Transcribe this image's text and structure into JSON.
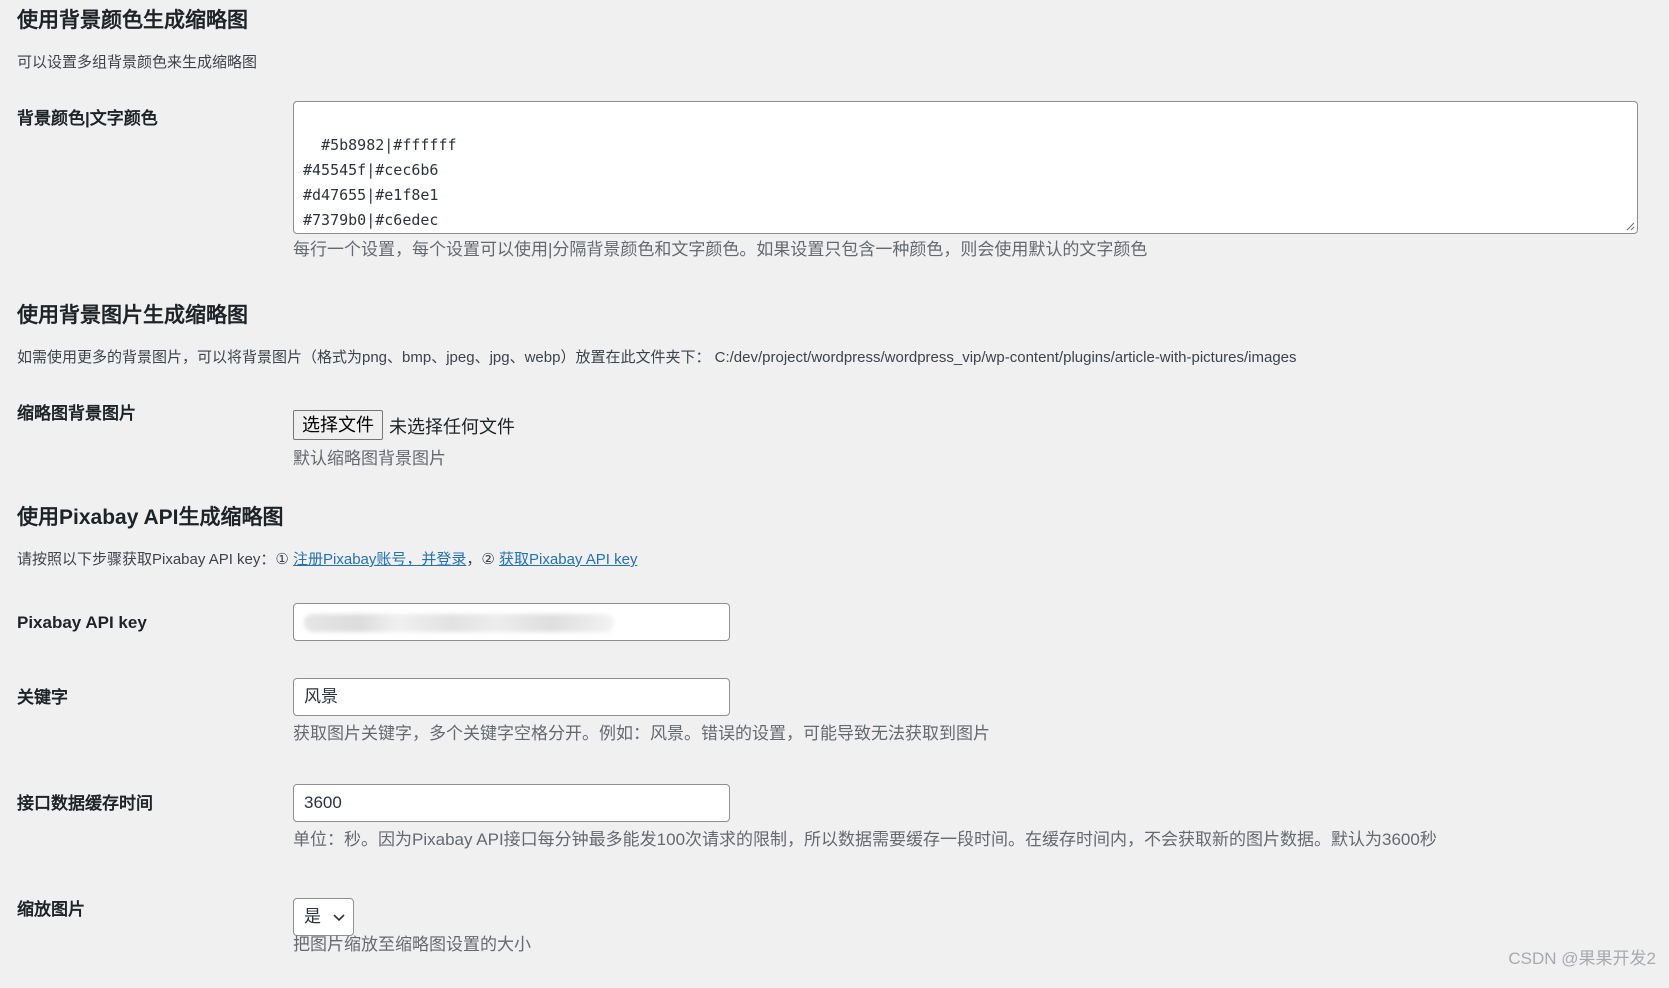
{
  "sections": {
    "background_color": {
      "title": "使用背景颜色生成缩略图",
      "description": "可以设置多组背景颜色来生成缩略图",
      "field_label": "背景颜色|文字颜色",
      "textarea_value": "#5b8982|#ffffff\n#45545f|#cec6b6\n#d47655|#e1f8e1\n#7379b0|#c6edec",
      "help_text": "每行一个设置，每个设置可以使用|分隔背景颜色和文字颜色。如果设置只包含一种颜色，则会使用默认的文字颜色"
    },
    "background_image": {
      "title": "使用背景图片生成缩略图",
      "description": "如需使用更多的背景图片，可以将背景图片（格式为png、bmp、jpeg、jpg、webp）放置在此文件夹下：  C:/dev/project/wordpress/wordpress_vip/wp-content/plugins/article-with-pictures/images",
      "field_label": "缩略图背景图片",
      "file_button_label": "选择文件",
      "file_status": "未选择任何文件",
      "help_text": "默认缩略图背景图片"
    },
    "pixabay": {
      "title": "使用Pixabay API生成缩略图",
      "description_prefix": "请按照以下步骤获取Pixabay API key：",
      "step1_marker": "①",
      "step1_link": "注册Pixabay账号，并登录",
      "separator": "，",
      "step2_marker": "②",
      "step2_link": "获取Pixabay API key",
      "api_key_label": "Pixabay API key",
      "keyword_label": "关键字",
      "keyword_value": "风景",
      "keyword_help": "获取图片关键字，多个关键字空格分开。例如：风景。错误的设置，可能导致无法获取到图片",
      "cache_label": "接口数据缓存时间",
      "cache_value": "3600",
      "cache_help": "单位：秒。因为Pixabay API接口每分钟最多能发100次请求的限制，所以数据需要缓存一段时间。在缓存时间内，不会获取新的图片数据。默认为3600秒",
      "scale_label": "缩放图片",
      "scale_value": "是",
      "scale_help": "把图片缩放至缩略图设置的大小"
    }
  },
  "watermark": "CSDN @果果开发2"
}
